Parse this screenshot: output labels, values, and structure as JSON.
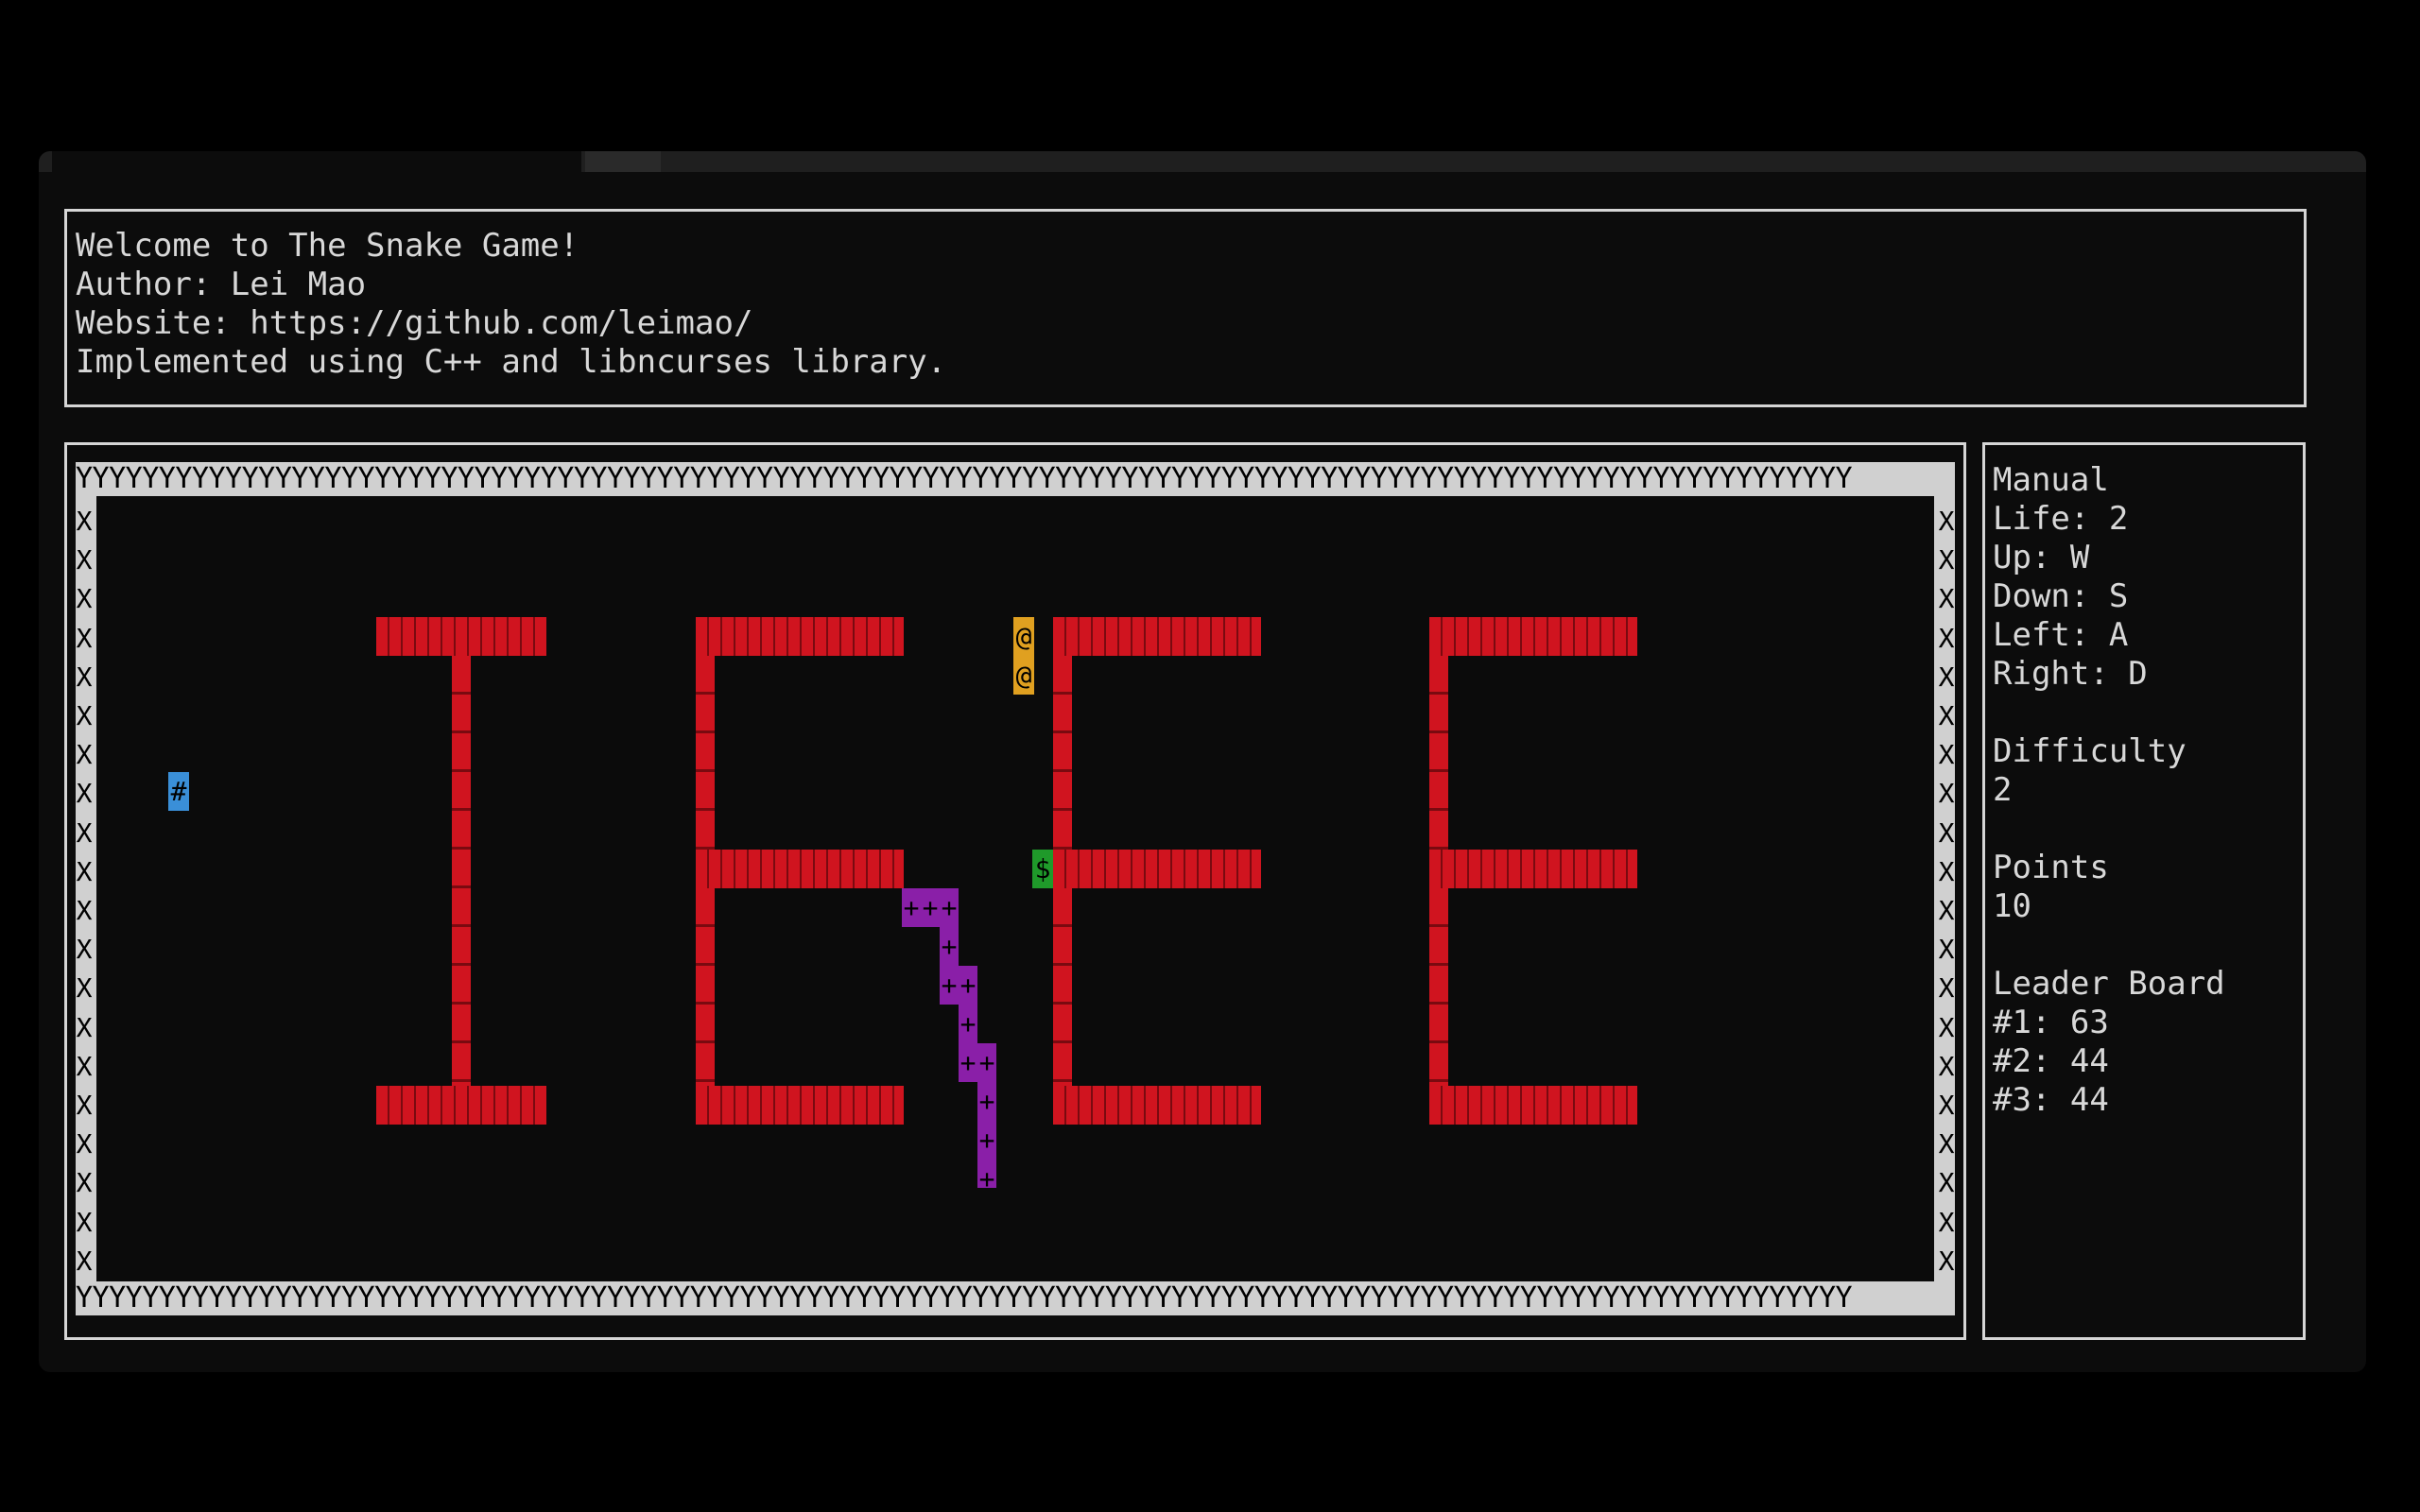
{
  "welcome": {
    "lines": [
      "Welcome to The Snake Game!",
      "Author: Lei Mao",
      "Website: https://github.com/leimao/",
      "Implemented using C++ and libncurses library."
    ]
  },
  "board": {
    "top_wall": "YYYYYYYYYYYYYYYYYYYYYYYYYYYYYYYYYYYYYYYYYYYYYYYYYYYYYYYYYYYYYYYYYYYYYYYYYYYYYYYYYYYYYYYYYYYYYYYYYYYYYYYYYYY",
    "bottom_wall": "YYYYYYYYYYYYYYYYYYYYYYYYYYYYYYYYYYYYYYYYYYYYYYYYYYYYYYYYYYYYYYYYYYYYYYYYYYYYYYYYYYYYYYYYYYYYYYYYYYYYYYYYYYY",
    "side_wall_char": "X",
    "snake_head_char": "@",
    "snake_body_char": "+",
    "food_char": "$",
    "poison_char": "#",
    "colors": {
      "wall_bg": "#d0d0d0",
      "obstacle": "#d0141f",
      "snake_head": "#e0a020",
      "snake_body": "#8a1fa8",
      "food": "#1f9a2a",
      "poison": "#3a8fd8"
    }
  },
  "sidebar": {
    "mode": "Manual",
    "life": "Life: 2",
    "up": "Up: W",
    "down": "Down: S",
    "left": "Left: A",
    "right": "Right: D",
    "difficulty_label": "Difficulty",
    "difficulty_value": "2",
    "points_label": "Points",
    "points_value": "10",
    "leaderboard_label": "Leader Board",
    "leaderboard": [
      "#1: 63",
      "#2: 44",
      "#3: 44"
    ]
  }
}
